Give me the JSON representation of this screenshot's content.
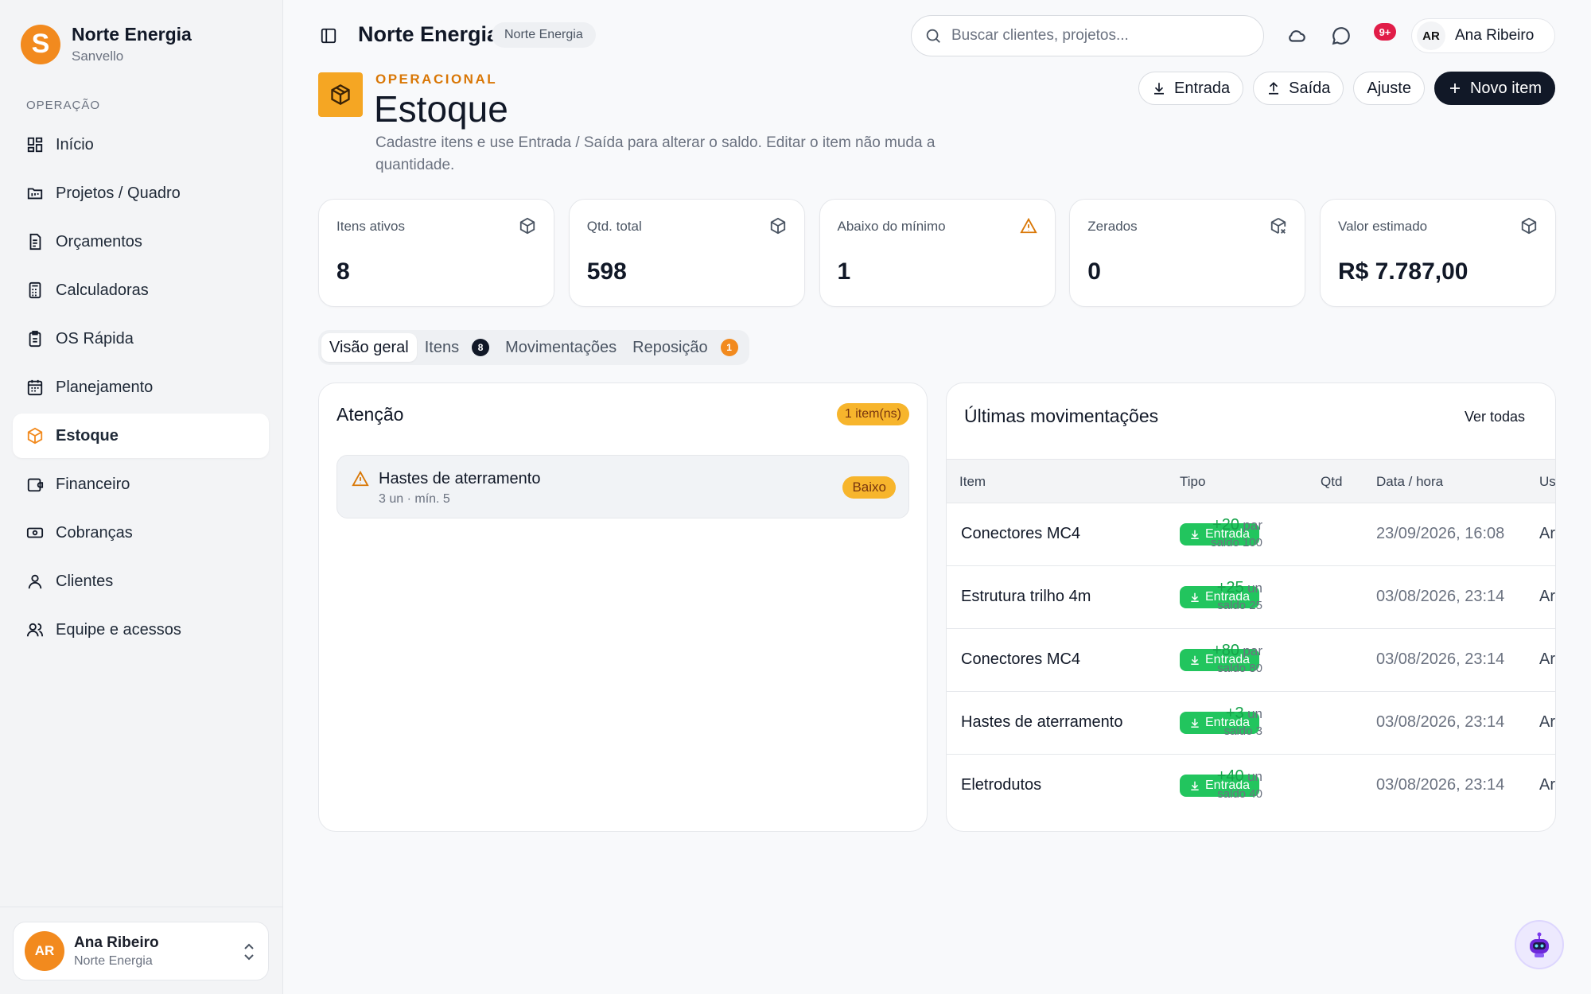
{
  "brand": {
    "logo_letter": "S",
    "name": "Norte Energia",
    "sub": "Sanvello"
  },
  "sidebar": {
    "section": "OPERAÇÃO",
    "items": [
      {
        "label": "Início",
        "icon": "grid-icon"
      },
      {
        "label": "Projetos / Quadro",
        "icon": "kanban-icon"
      },
      {
        "label": "Orçamentos",
        "icon": "document-icon"
      },
      {
        "label": "Calculadoras",
        "icon": "calculator-icon"
      },
      {
        "label": "OS Rápida",
        "icon": "clipboard-icon"
      },
      {
        "label": "Planejamento",
        "icon": "calendar-icon"
      },
      {
        "label": "Estoque",
        "icon": "box-icon",
        "active": true
      },
      {
        "label": "Financeiro",
        "icon": "wallet-icon"
      },
      {
        "label": "Cobranças",
        "icon": "banknote-icon"
      },
      {
        "label": "Clientes",
        "icon": "user-icon"
      },
      {
        "label": "Equipe e acessos",
        "icon": "users-icon"
      }
    ],
    "user": {
      "initials": "AR",
      "name": "Ana Ribeiro",
      "org": "Norte Energia"
    }
  },
  "topbar": {
    "title": "Norte Energia",
    "tag": "Norte Energia",
    "search_placeholder": "Buscar clientes, projetos...",
    "notifications": "9+",
    "user_initials": "AR",
    "user_name": "Ana Ribeiro"
  },
  "page": {
    "eyebrow": "OPERACIONAL",
    "title": "Estoque",
    "description": "Cadastre itens e use Entrada / Saída para alterar o saldo. Editar o item não muda a quantidade.",
    "actions": {
      "entrada": "Entrada",
      "saida": "Saída",
      "ajuste": "Ajuste",
      "novo": "Novo item"
    }
  },
  "kpis": [
    {
      "label": "Itens ativos",
      "value": "8",
      "icon": "box-icon"
    },
    {
      "label": "Qtd. total",
      "value": "598",
      "icon": "box-icon"
    },
    {
      "label": "Abaixo do mínimo",
      "value": "1",
      "icon": "warning-icon"
    },
    {
      "label": "Zerados",
      "value": "0",
      "icon": "box-x-icon"
    },
    {
      "label": "Valor estimado",
      "value": "R$ 7.787,00",
      "icon": "box-icon"
    }
  ],
  "tabs": [
    {
      "label": "Visão geral",
      "active": true
    },
    {
      "label": "Itens",
      "badge": "8"
    },
    {
      "label": "Movimentações"
    },
    {
      "label": "Reposição",
      "badge": "1"
    }
  ],
  "attention": {
    "title": "Atenção",
    "count": "1 item(ns)",
    "items": [
      {
        "name": "Hastes de aterramento",
        "sub": "3 un · mín. 5",
        "status": "Baixo"
      }
    ]
  },
  "movements": {
    "title": "Últimas movimentações",
    "see_all": "Ver todas",
    "columns": {
      "item": "Item",
      "tipo": "Tipo",
      "qtd": "Qtd",
      "data": "Data / hora",
      "user": "Us"
    },
    "rows": [
      {
        "item": "Conectores MC4",
        "tipo": "Entrada",
        "qtd": "+20",
        "unit": "par",
        "saldo": "saldo 100",
        "date": "23/09/2026, 16:08",
        "user": "Ar"
      },
      {
        "item": "Estrutura trilho 4m",
        "tipo": "Entrada",
        "qtd": "+25",
        "unit": "un",
        "saldo": "saldo 25",
        "date": "03/08/2026, 23:14",
        "user": "Ar"
      },
      {
        "item": "Conectores MC4",
        "tipo": "Entrada",
        "qtd": "+80",
        "unit": "par",
        "saldo": "saldo 80",
        "date": "03/08/2026, 23:14",
        "user": "Ar"
      },
      {
        "item": "Hastes de aterramento",
        "tipo": "Entrada",
        "qtd": "+3",
        "unit": "un",
        "saldo": "saldo 3",
        "date": "03/08/2026, 23:14",
        "user": "Ar"
      },
      {
        "item": "Eletrodutos",
        "tipo": "Entrada",
        "qtd": "+40",
        "unit": "un",
        "saldo": "saldo 40",
        "date": "03/08/2026, 23:14",
        "user": "Ar"
      }
    ]
  },
  "colors": {
    "accent": "#f28a1e",
    "dark": "#111827",
    "success": "#22c55e",
    "warning": "#f7b52c",
    "danger": "#e11d48"
  }
}
